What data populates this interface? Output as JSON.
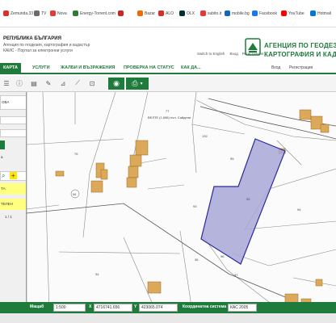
{
  "bookmarks": [
    {
      "label": "Zemunda.33",
      "color": "#d9322b"
    },
    {
      "label": "TV",
      "color": "#6a6a6a"
    },
    {
      "label": "Nova",
      "color": "#e53935"
    },
    {
      "label": "Energy-Torrent.com",
      "color": "#2e7d32"
    },
    {
      "label": "",
      "color": "#c62828"
    },
    {
      "label": "Bazar",
      "color": "#ef6c00"
    },
    {
      "label": "ALO",
      "color": "#d32f2f"
    },
    {
      "label": "OLX",
      "color": "#002f34"
    },
    {
      "label": "subito.it",
      "color": "#e53935"
    },
    {
      "label": "mobile.bg",
      "color": "#1565c0"
    },
    {
      "label": "Facebook",
      "color": "#1877f2"
    },
    {
      "label": "YouTube",
      "color": "#ff0000"
    },
    {
      "label": "Hotmail",
      "color": "#0078d4"
    }
  ],
  "header": {
    "title": "РЕПУБЛИКА БЪЛГАРИЯ",
    "subtitle1": "Агенция по геодезия, картография и кадастър",
    "subtitle2": "КАИС - Портал за електронни услуги",
    "switch_english": "Switch to English",
    "login": "Вход",
    "register": "Регистрация",
    "agency_line1": "АГЕНЦИЯ ПО ГЕОДЕЗИЯ",
    "agency_line2": "КАРТОГРАФИЯ И КАДА"
  },
  "nav": {
    "items": [
      "КАРТА",
      "УСЛУГИ",
      "ЖАЛБИ И ВЪЗРАЖЕНИЯ",
      "ПРОВЕРКА НА СТАТУС",
      "КАК ДА..."
    ],
    "right_items": [
      "Вход",
      "Регистрация"
    ]
  },
  "left_panel": {
    "rows": [
      "ОВА",
      "а",
      "ТА",
      "ТЕЛЕН",
      "1 / 1"
    ]
  },
  "map": {
    "labels": [
      {
        "text": "77"
      },
      {
        "text": "132"
      },
      {
        "text": "75"
      },
      {
        "text": "93"
      },
      {
        "text": "92"
      },
      {
        "text": "94"
      },
      {
        "text": "95"
      },
      {
        "text": "34"
      },
      {
        "text": "36"
      },
      {
        "text": "37"
      },
      {
        "text": "96"
      },
      {
        "text": "56"
      }
    ],
    "street_label": "ВЕЛТЕ (1,656) пчл. Сайдени"
  },
  "statusbar": {
    "label_1": "Мащаб",
    "scale": "1:500",
    "x_label": "X",
    "x_value": "4716741.656",
    "y_label": "Y",
    "y_value": "423065.074",
    "crs_label": "Координатна система",
    "crs_value": "КАС 2005"
  },
  "colors": {
    "brand_green": "#1e7b3c",
    "selection_fill": "#a7a7d6",
    "selection_stroke": "#2a2a9e",
    "building_fill": "#dca95a"
  }
}
